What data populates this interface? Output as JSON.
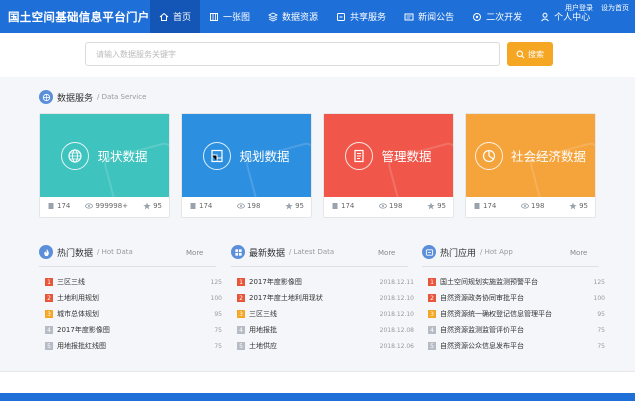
{
  "header": {
    "brand": "国土空间基础信息平台门户",
    "nav": [
      {
        "label": "首页",
        "icon": "home-icon",
        "active": true
      },
      {
        "label": "一张图",
        "icon": "map-icon",
        "active": false
      },
      {
        "label": "数据资源",
        "icon": "layers-icon",
        "active": false
      },
      {
        "label": "共享服务",
        "icon": "share-icon",
        "active": false
      },
      {
        "label": "新闻公告",
        "icon": "news-icon",
        "active": false
      },
      {
        "label": "二次开发",
        "icon": "dev-icon",
        "active": false
      },
      {
        "label": "个人中心",
        "icon": "user-icon",
        "active": false
      }
    ],
    "login": "用户登录",
    "set_home": "设为首页"
  },
  "search": {
    "placeholder": "请输入数据服务关键字",
    "button": "搜索"
  },
  "data_service": {
    "title": "数据服务",
    "subtitle": "/ Data Service",
    "cards": [
      {
        "title": "现状数据",
        "color": "#3fc3be",
        "icon": "globe-icon",
        "files": "174",
        "views": "999998+",
        "stars": "95"
      },
      {
        "title": "规划数据",
        "color": "#2d8fe0",
        "icon": "plan-icon",
        "files": "174",
        "views": "198",
        "stars": "95"
      },
      {
        "title": "管理数据",
        "color": "#f0574a",
        "icon": "document-icon",
        "files": "174",
        "views": "198",
        "stars": "95"
      },
      {
        "title": "社会经济数据",
        "color": "#f5a33b",
        "icon": "pie-chart-icon",
        "files": "174",
        "views": "198",
        "stars": "95"
      }
    ]
  },
  "hot_data": {
    "title": "热门数据",
    "subtitle": "/ Hot Data",
    "more": "More",
    "items": [
      {
        "rank": "1",
        "label": "三区三线",
        "value": "125"
      },
      {
        "rank": "2",
        "label": "土地利用规划",
        "value": "100"
      },
      {
        "rank": "3",
        "label": "城市总体规划",
        "value": "95"
      },
      {
        "rank": "4",
        "label": "2017年度影像图",
        "value": "75"
      },
      {
        "rank": "5",
        "label": "用地报批红线图",
        "value": "75"
      }
    ]
  },
  "latest_data": {
    "title": "最新数据",
    "subtitle": "/ Latest Data",
    "more": "More",
    "items": [
      {
        "rank": "1",
        "label": "2017年度影像图",
        "value": "2018.12.11"
      },
      {
        "rank": "2",
        "label": "2017年度土地利用现状",
        "value": "2018.12.10"
      },
      {
        "rank": "3",
        "label": "三区三线",
        "value": "2018.12.10"
      },
      {
        "rank": "4",
        "label": "用地报批",
        "value": "2018.12.08"
      },
      {
        "rank": "5",
        "label": "土地供应",
        "value": "2018.12.06"
      }
    ]
  },
  "hot_app": {
    "title": "热门应用",
    "subtitle": "/ Hot App",
    "more": "More",
    "items": [
      {
        "rank": "1",
        "label": "国土空间规划实施监测预警平台",
        "value": "125"
      },
      {
        "rank": "2",
        "label": "自然资源政务协同审批平台",
        "value": "100"
      },
      {
        "rank": "3",
        "label": "自然资源统一确权登记信息管理平台",
        "value": "95"
      },
      {
        "rank": "4",
        "label": "自然资源监测监管评价平台",
        "value": "75"
      },
      {
        "rank": "5",
        "label": "自然资源公众信息发布平台",
        "value": "75"
      }
    ]
  },
  "colors": {
    "primary": "#1e6fd8",
    "nav_active": "#1456b5",
    "search_button": "#f5a623",
    "rank_top": "#e8553a",
    "rank_mid": "#f5a623",
    "rank_other": "#b5bcc6"
  }
}
